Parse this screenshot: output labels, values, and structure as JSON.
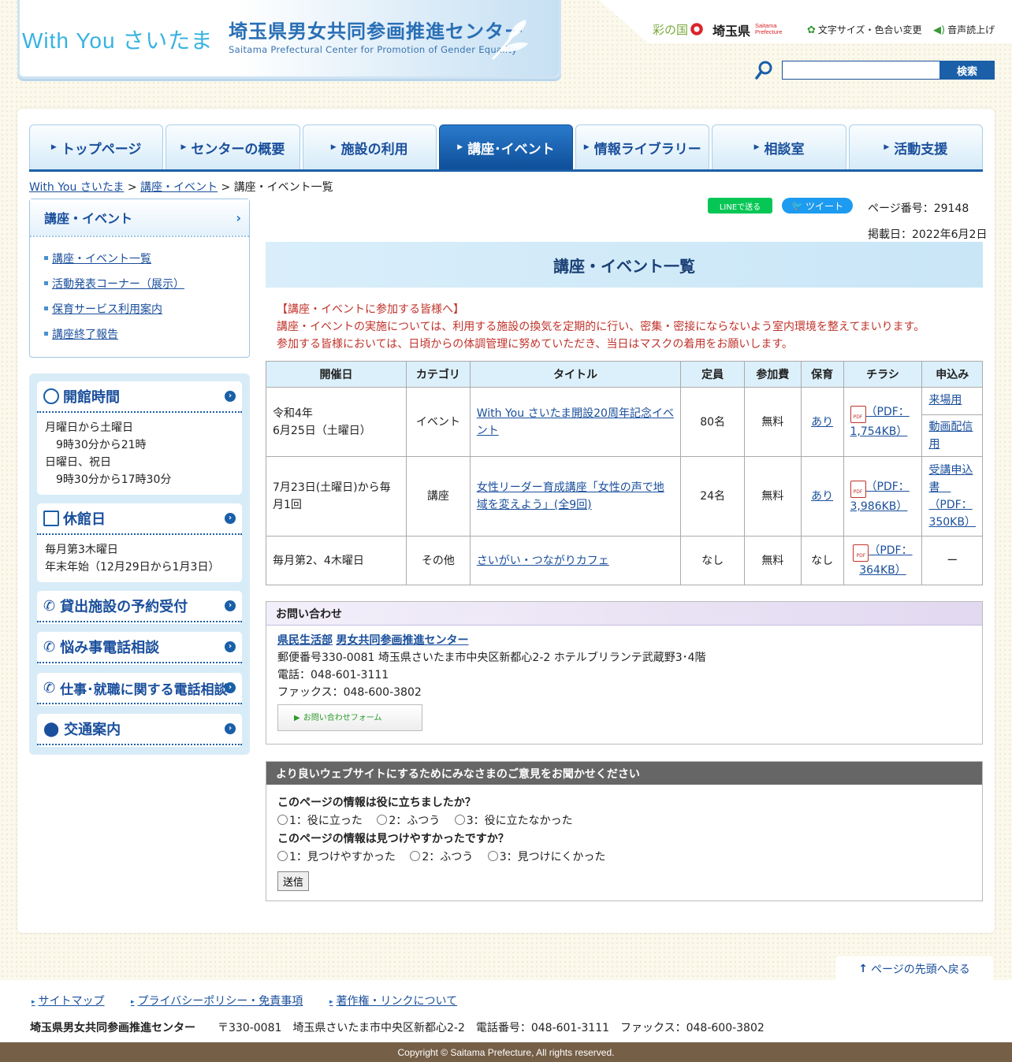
{
  "header": {
    "logo_withyou": "With You さいたま",
    "logo_jp": "埼玉県男女共同参画推進センター",
    "logo_en": "Saitama Prefectural Center for Promotion of Gender Equality",
    "sainokuni": "彩の国",
    "saitamaken": "埼玉県",
    "saitama_en_1": "Saitama",
    "saitama_en_2": "Prefecture",
    "font_change": "文字サイズ・色合い変更",
    "voice": "音声読上げ",
    "search_button": "検索",
    "search_value": ""
  },
  "nav": [
    {
      "label": "トップページ"
    },
    {
      "label": "センターの概要"
    },
    {
      "label": "施設の利用"
    },
    {
      "label": "講座･イベント"
    },
    {
      "label": "情報ライブラリー"
    },
    {
      "label": "相談室"
    },
    {
      "label": "活動支援"
    }
  ],
  "breadcrumb": {
    "home": "With You さいたま",
    "parent": "講座・イベント",
    "current": "講座・イベント一覧",
    "sep": ">"
  },
  "sidebar": {
    "title": "講座・イベント",
    "links": [
      "講座・イベント一覧",
      "活動発表コーナー（展示）",
      "保育サービス利用案内",
      "講座終了報告"
    ]
  },
  "info": {
    "hours_title": "開館時間",
    "hours_lines": [
      "月曜日から土曜日",
      "　9時30分から21時",
      "日曜日、祝日",
      "　9時30分から17時30分"
    ],
    "closed_title": "休館日",
    "closed_lines": [
      "毎月第3木曜日",
      "年末年始（12月29日から1月3日）"
    ],
    "rental": "貸出施設の予約受付",
    "phone": "悩み事電話相談",
    "job": "仕事･就職に関する電話相談",
    "access": "交通案内"
  },
  "share": {
    "line": "LINEで送る",
    "tweet": "ツイート"
  },
  "meta": {
    "page_no": "ページ番号：29148",
    "pub_date": "掲載日：2022年6月2日"
  },
  "main": {
    "title": "講座・イベント一覧",
    "notice": [
      "【講座・イベントに参加する皆様へ】",
      "講座・イベントの実施については、利用する施設の換気を定期的に行い、密集・密接にならないよう室内環境を整えてまいります。",
      "参加する皆様においては、日頃からの体調管理に努めていただき、当日はマスクの着用をお願いします。"
    ],
    "table_headers": [
      "開催日",
      "カテゴリ",
      "タイトル",
      "定員",
      "参加費",
      "保育",
      "チラシ",
      "申込み"
    ],
    "rows": [
      {
        "date_1": "令和4年",
        "date_2": "6月25日（土曜日）",
        "category": "イベント",
        "title": "With You さいたま開設20周年記念イベント",
        "capacity": "80名",
        "fee": "無料",
        "childcare": "あり",
        "flyer": "（PDF：1,754KB）",
        "apply_1": "来場用",
        "apply_2": "動画配信用"
      },
      {
        "date_1": "7月23日(土曜日)から毎月1回",
        "date_2": "",
        "category": "講座",
        "title": "女性リーダー育成講座「女性の声で地域を変えよう」(全9回)",
        "capacity": "24名",
        "fee": "無料",
        "childcare": "あり",
        "flyer": "（PDF：3,986KB）",
        "apply_1": "受講申込書　（PDF：350KB）",
        "apply_2": ""
      },
      {
        "date_1": "毎月第2、4木曜日",
        "date_2": "",
        "category": "その他",
        "title": "さいがい・つながりカフェ",
        "capacity": "なし",
        "fee": "無料",
        "childcare": "なし",
        "flyer": "（PDF：364KB）",
        "apply_1": "ー",
        "apply_2": ""
      }
    ]
  },
  "contact": {
    "head": "お問い合わせ",
    "dept": "県民生活部",
    "org": "男女共同参画推進センター",
    "postal": "郵便番号330-0081 埼玉県さいたま市中央区新都心2-2 ホテルブリランテ武蔵野3･4階",
    "tel": "電話：048-601-3111",
    "fax": "ファックス：048-600-3802",
    "form_button": "お問い合わせフォーム"
  },
  "feedback": {
    "head": "より良いウェブサイトにするためにみなさまのご意見をお聞かせください",
    "q1": "このページの情報は役に立ちましたか？",
    "q1_options": [
      "1：役に立った",
      "2：ふつう",
      "3：役に立たなかった"
    ],
    "q2": "このページの情報は見つけやすかったですか？",
    "q2_options": [
      "1：見つけやすかった",
      "2：ふつう",
      "3：見つけにくかった"
    ],
    "submit": "送信"
  },
  "footer": {
    "to_top": "ページの先頭へ戻る",
    "links": [
      "サイトマップ",
      "プライバシーポリシー・免責事項",
      "著作権・リンクについて"
    ],
    "org": "埼玉県男女共同参画推進センター",
    "address": "〒330-0081　埼玉県さいたま市中央区新都心2-2　電話番号：048-601-3111　ファックス：048-600-3802",
    "copyright": "Copyright © Saitama Prefecture, All rights reserved."
  },
  "colors": {
    "accent": "#1a5fa8",
    "notice": "#c0332b",
    "footer_bar": "#765f47"
  }
}
